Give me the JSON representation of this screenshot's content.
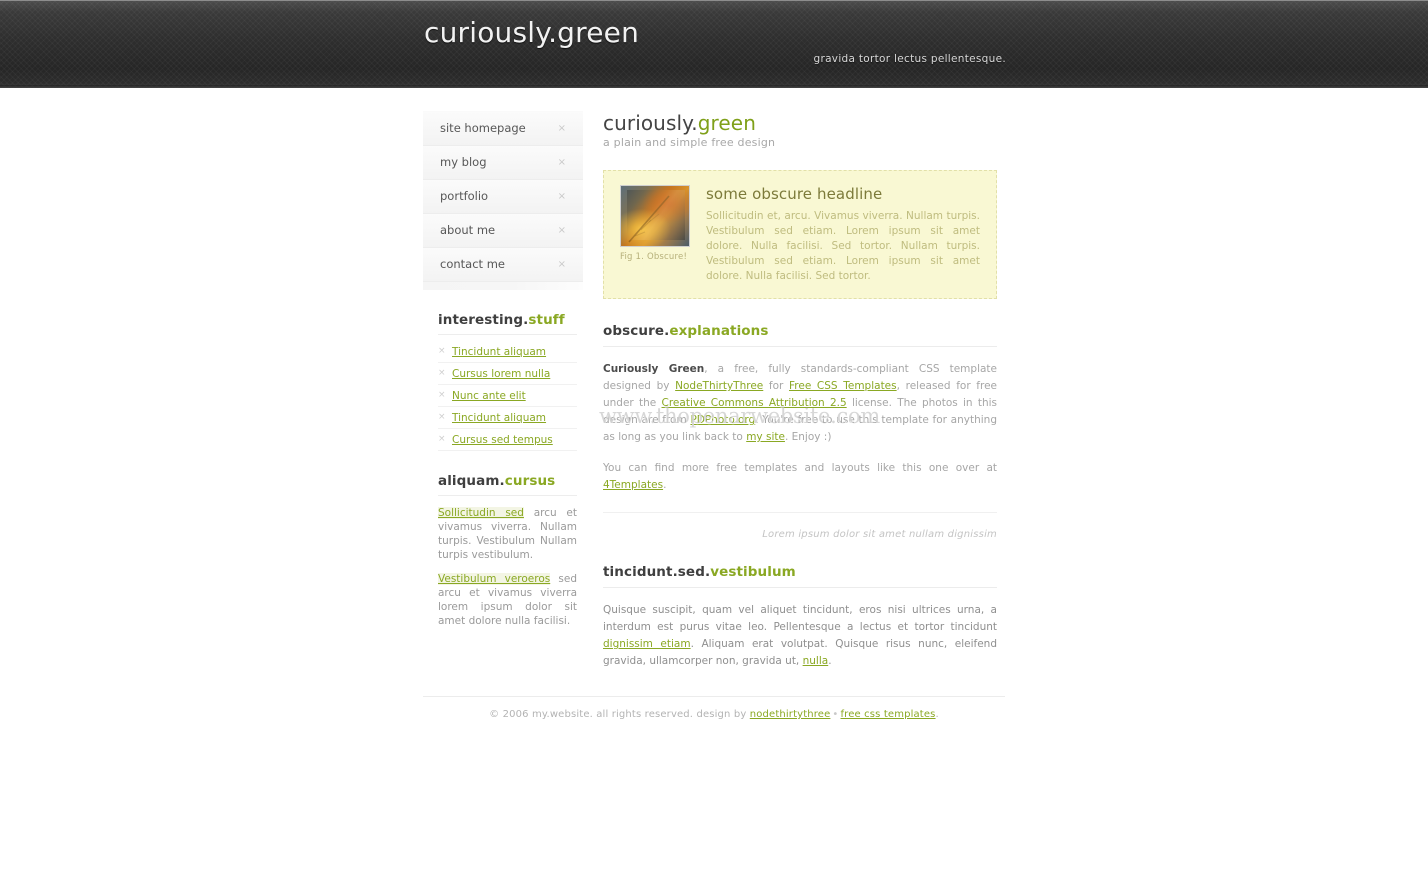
{
  "masthead": {
    "brand_name": "curiously",
    "brand_dot": ".",
    "brand_accent": "green",
    "tagline": "gravida tortor lectus pellentesque."
  },
  "sidebar": {
    "nav": [
      {
        "label": "site homepage",
        "close": "×"
      },
      {
        "label": "my blog",
        "close": "×"
      },
      {
        "label": "portfolio",
        "close": "×"
      },
      {
        "label": "about me",
        "close": "×"
      },
      {
        "label": "contact me",
        "close": "×"
      }
    ],
    "interesting": {
      "heading_main": "interesting",
      "heading_dot": ".",
      "heading_accent": "stuff",
      "items": [
        {
          "bullet": "×",
          "label": "Tincidunt aliquam"
        },
        {
          "bullet": "×",
          "label": "Cursus lorem nulla"
        },
        {
          "bullet": "×",
          "label": "Nunc ante elit"
        },
        {
          "bullet": "×",
          "label": "Tincidunt aliquam"
        },
        {
          "bullet": "×",
          "label": "Cursus sed tempus"
        }
      ]
    },
    "aliquam": {
      "heading_main": "aliquam",
      "heading_dot": ".",
      "heading_accent": "cursus",
      "para1_link": "Sollicitudin sed",
      "para1_text": " arcu et vivamus viverra. Nullam turpis. Vestibulum Nullam turpis vestibulum.",
      "para2_link": "Vestibulum veroeros",
      "para2_text": " sed arcu et vivamus viverra lorem ipsum dolor sit amet dolore nulla facilisi."
    }
  },
  "main": {
    "title_main": "curiously",
    "title_dot": ".",
    "title_accent": "green",
    "subtitle": "a plain and simple free design",
    "feature": {
      "figure_caption": "Fig 1. Obscure!",
      "headline": "some obscure headline",
      "body": "Sollicitudin et, arcu. Vivamus viverra. Nullam turpis. Vestibulum sed etiam. Lorem ipsum sit amet dolore. Nulla facilisi. Sed tortor. Nullam turpis. Vestibulum sed etiam. Lorem ipsum sit amet dolore. Nulla facilisi. Sed tortor."
    },
    "explanations": {
      "heading_main": "obscure",
      "heading_dot": ".",
      "heading_accent": "explanations",
      "p1_strong": "Curiously Green",
      "p1_a": ", a free, fully standards-compliant CSS template designed by ",
      "link_nodethirtythree": "NodeThirtyThree",
      "p1_b": " for ",
      "link_freecss": "Free CSS Templates",
      "p1_c": ", released for free under the ",
      "link_cc": "Creative Commons Attribution 2.5",
      "p1_d": " license. The photos in this design are from ",
      "link_pdphoto": "PDPhoto.org",
      "p1_e": ". You're free to use this template for anything as long as you link back to ",
      "link_mysite": "my site",
      "p1_f": ". Enjoy :)",
      "p2_a": "You can find more free templates and layouts like this one over at ",
      "link_4templates": "4Templates",
      "p2_b": "."
    },
    "watermark": "www.thopenarwebsite.com",
    "quote": "Lorem ipsum dolor sit amet nullam dignissim",
    "tincidunt": {
      "heading_main": "tincidunt",
      "heading_dot1": ".",
      "heading_mid": "sed",
      "heading_dot2": ".",
      "heading_accent": "vestibulum",
      "p_a": "Quisque suscipit, quam vel aliquet tincidunt, eros nisi ultrices urna, a interdum est purus vitae leo. Pellentesque a lectus et tortor tincidunt ",
      "link_dignissim": "dignissim etiam",
      "p_b": ". Aliquam erat volutpat. Quisque risus nunc, eleifend gravida, ullamcorper non, gravida ut, ",
      "link_nulla": "nulla",
      "p_c": "."
    }
  },
  "footer": {
    "copyright": "© 2006 my.website. all rights reserved. design by ",
    "link_nodethirtythree": "nodethirtythree",
    "separator": "•",
    "link_freecss": "free css templates",
    "period": "."
  },
  "colors": {
    "accent_green": "#8aa823",
    "header_dark": "#2e2e2e",
    "feature_yellow": "#f9f8d3",
    "text_gray": "#a6a6a6"
  }
}
